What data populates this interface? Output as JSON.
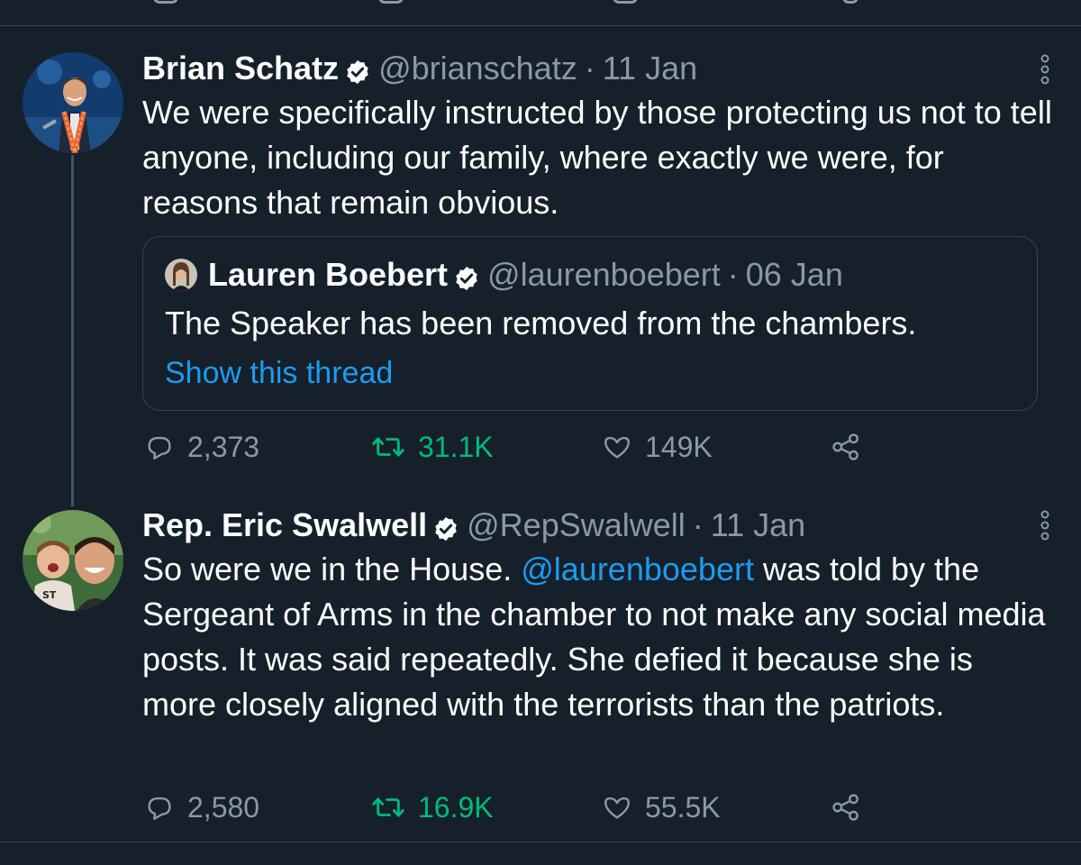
{
  "tweets": [
    {
      "name": "Brian Schatz",
      "handle": "@brianschatz",
      "separator": "·",
      "date": "11 Jan",
      "text": "We were specifically instructed by those protecting us not to tell anyone, including our family, where exactly we were, for reasons that remain obvious.",
      "quote": {
        "name": "Lauren Boebert",
        "handle": "@laurenboebert",
        "separator": "·",
        "date": "06 Jan",
        "text": "The Speaker has been removed from the chambers.",
        "link": "Show this thread"
      },
      "replies": "2,373",
      "retweets": "31.1K",
      "likes": "149K"
    },
    {
      "name": "Rep. Eric Swalwell",
      "handle": "@RepSwalwell",
      "separator": "·",
      "date": "11 Jan",
      "text_before": "So were we in the House. ",
      "mention": "@laurenboebert",
      "text_after": " was told by the Sergeant of Arms in the chamber to not make any social media posts. It was said repeatedly. She defied it because she is more closely aligned with the terrorists than the patriots.",
      "replies": "2,580",
      "retweets": "16.9K",
      "likes": "55.5K"
    }
  ],
  "colors": {
    "background": "#15202b",
    "accent": "#1d9bf0",
    "retweet": "#00ba7c",
    "muted": "#8b98a5",
    "border": "#38444d"
  },
  "icons": [
    "verified-badge-icon",
    "more-options-icon",
    "reply-icon",
    "retweet-icon",
    "like-icon",
    "share-icon"
  ]
}
